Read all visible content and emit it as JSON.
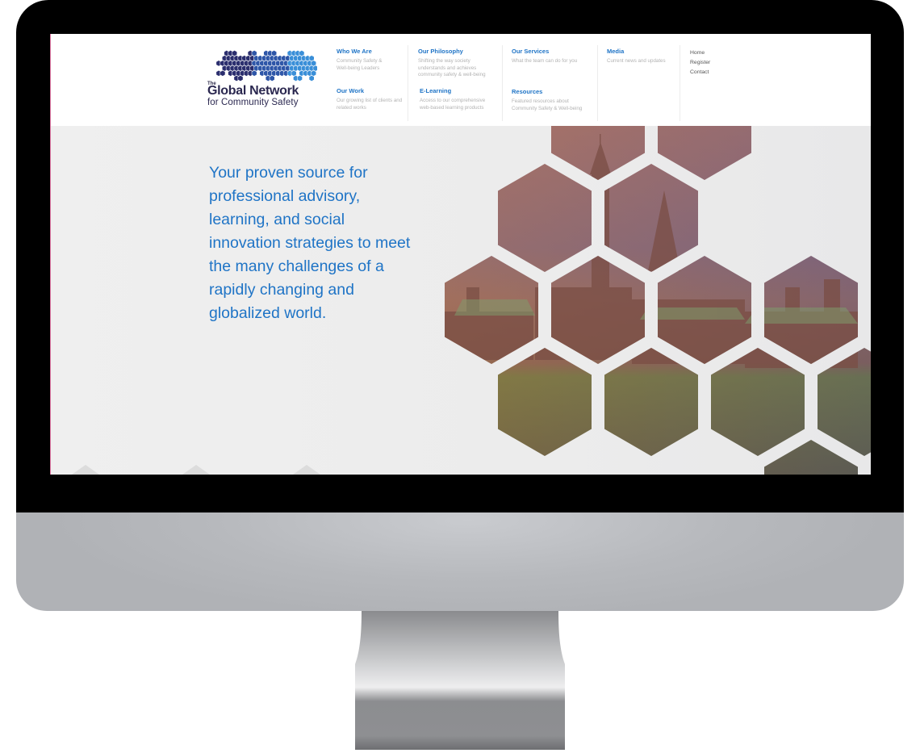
{
  "logo": {
    "the": "The",
    "name": "Global Network",
    "tagline": "for Community Safety",
    "colors": [
      "#2b2e6e",
      "#2e56a8",
      "#3a8fd8"
    ]
  },
  "nav": {
    "columns": [
      {
        "items": [
          {
            "title": "Who We Are",
            "desc": "Community Safety & Well-being Leaders"
          },
          {
            "title": "Our Work",
            "desc": "Our growing list of clients and related works"
          }
        ]
      },
      {
        "items": [
          {
            "title": "Our Philosophy",
            "desc": "Shifting the way society understands and achieves community safety & well-being"
          },
          {
            "title": "E-Learning",
            "desc": "Access to our comprehensive web-based learning products"
          }
        ]
      },
      {
        "items": [
          {
            "title": "Our Services",
            "desc": "What the team can do for you"
          },
          {
            "title": "Resources",
            "desc": "Featured resources about Community Safety & Well-being"
          }
        ]
      },
      {
        "items": [
          {
            "title": "Media",
            "desc": "Current news and updates"
          }
        ]
      }
    ],
    "utility": [
      "Home",
      "Register",
      "Contact"
    ]
  },
  "hero": {
    "headline": "Your proven source for professional advisory, learning, and social innovation strategies to meet the many challenges of a rapidly changing and globalized world.",
    "image_subject": "Parliament Hill hexagon photo collage",
    "accent_color": "#1f74c6"
  }
}
